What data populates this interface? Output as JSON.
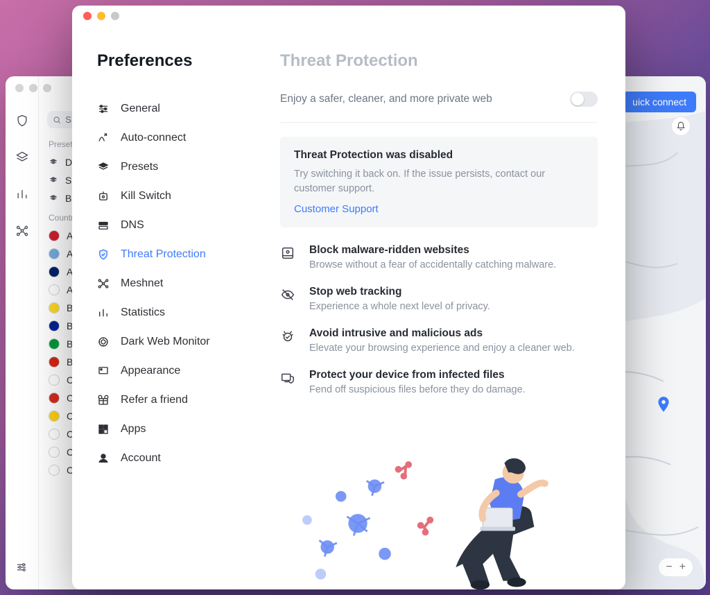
{
  "bg": {
    "search_placeholder": "S",
    "section_presets": "Preset",
    "presets": [
      "De",
      "Sp",
      "Br"
    ],
    "section_countries": "Countr",
    "countries": [
      {
        "name": "Al",
        "flag": "#d01f2e"
      },
      {
        "name": "Ar",
        "flag": "#74acdf"
      },
      {
        "name": "Au",
        "flag": "#012169"
      },
      {
        "name": "Au",
        "flag": "#ffffff"
      },
      {
        "name": "Be",
        "flag": "#fdda24"
      },
      {
        "name": "Bo",
        "flag": "#002395"
      },
      {
        "name": "Br",
        "flag": "#009b3a"
      },
      {
        "name": "Bu",
        "flag": "#d62612"
      },
      {
        "name": "Ca",
        "flag": "#ffffff"
      },
      {
        "name": "Cl",
        "flag": "#d52b1e"
      },
      {
        "name": "Co",
        "flag": "#fcd116"
      },
      {
        "name": "Co",
        "flag": "#ffffff"
      },
      {
        "name": "Cr",
        "flag": "#ffffff"
      },
      {
        "name": "Cy",
        "flag": "#ffffff"
      }
    ],
    "quick_connect": "uick connect"
  },
  "prefs": {
    "title": "Preferences",
    "nav": [
      {
        "key": "general",
        "label": "General"
      },
      {
        "key": "autoconnect",
        "label": "Auto-connect"
      },
      {
        "key": "presets",
        "label": "Presets"
      },
      {
        "key": "killswitch",
        "label": "Kill Switch"
      },
      {
        "key": "dns",
        "label": "DNS"
      },
      {
        "key": "threat",
        "label": "Threat Protection",
        "active": true
      },
      {
        "key": "meshnet",
        "label": "Meshnet"
      },
      {
        "key": "statistics",
        "label": "Statistics"
      },
      {
        "key": "darkweb",
        "label": "Dark Web Monitor"
      },
      {
        "key": "appearance",
        "label": "Appearance"
      },
      {
        "key": "refer",
        "label": "Refer a friend"
      },
      {
        "key": "apps",
        "label": "Apps"
      },
      {
        "key": "account",
        "label": "Account"
      }
    ]
  },
  "main": {
    "title": "Threat Protection",
    "toggle_desc": "Enjoy a safer, cleaner, and more private web",
    "alert": {
      "title": "Threat Protection was disabled",
      "text": "Try switching it back on. If the issue persists, contact our customer support.",
      "link": "Customer Support"
    },
    "benefits": [
      {
        "title": "Block malware-ridden websites",
        "desc": "Browse without a fear of accidentally catching malware."
      },
      {
        "title": "Stop web tracking",
        "desc": "Experience a whole next level of privacy."
      },
      {
        "title": "Avoid intrusive and malicious ads",
        "desc": "Elevate your browsing experience and enjoy a cleaner web."
      },
      {
        "title": "Protect your device from infected files",
        "desc": "Fend off suspicious files before they do damage."
      }
    ]
  }
}
